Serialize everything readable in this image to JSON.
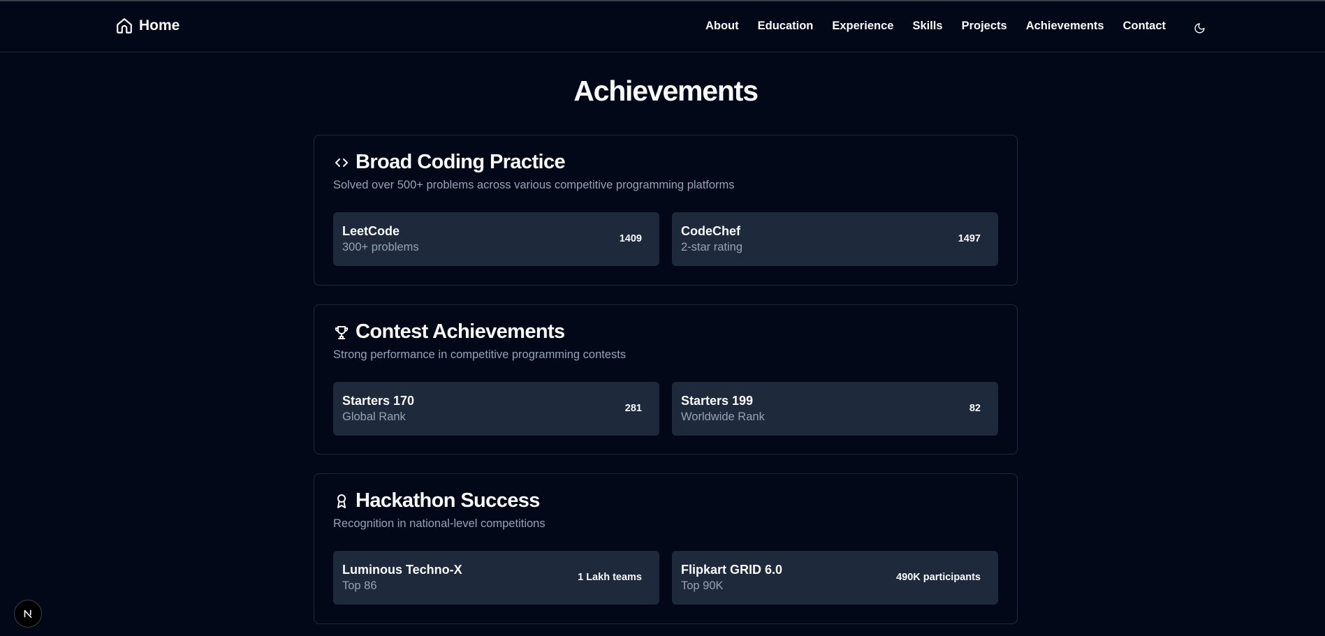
{
  "header": {
    "brand_label": "Home",
    "brand_icon": "home-icon",
    "nav": [
      "About",
      "Education",
      "Experience",
      "Skills",
      "Projects",
      "Achievements",
      "Contact"
    ],
    "theme_icon": "moon-icon"
  },
  "page": {
    "title": "Achievements"
  },
  "sections": [
    {
      "icon": "code-icon",
      "title": "Broad Coding Practice",
      "description": "Solved over 500+ problems across various competitive programming platforms",
      "items": [
        {
          "name": "LeetCode",
          "sub": "300+ problems",
          "value": "1409"
        },
        {
          "name": "CodeChef",
          "sub": "2-star rating",
          "value": "1497"
        }
      ]
    },
    {
      "icon": "trophy-icon",
      "title": "Contest Achievements",
      "description": "Strong performance in competitive programming contests",
      "items": [
        {
          "name": "Starters 170",
          "sub": "Global Rank",
          "value": "281"
        },
        {
          "name": "Starters 199",
          "sub": "Worldwide Rank",
          "value": "82"
        }
      ]
    },
    {
      "icon": "award-icon",
      "title": "Hackathon Success",
      "description": "Recognition in national-level competitions",
      "items": [
        {
          "name": "Luminous Techno-X",
          "sub": "Top 86",
          "value": "1 Lakh teams"
        },
        {
          "name": "Flipkart GRID 6.0",
          "sub": "Top 90K",
          "value": "490K participants"
        }
      ]
    }
  ],
  "badge": {
    "label": "N"
  },
  "colors": {
    "background": "#020817",
    "card_item": "#1e293b",
    "muted_text": "#94a3b8",
    "border": "#1e293b"
  }
}
